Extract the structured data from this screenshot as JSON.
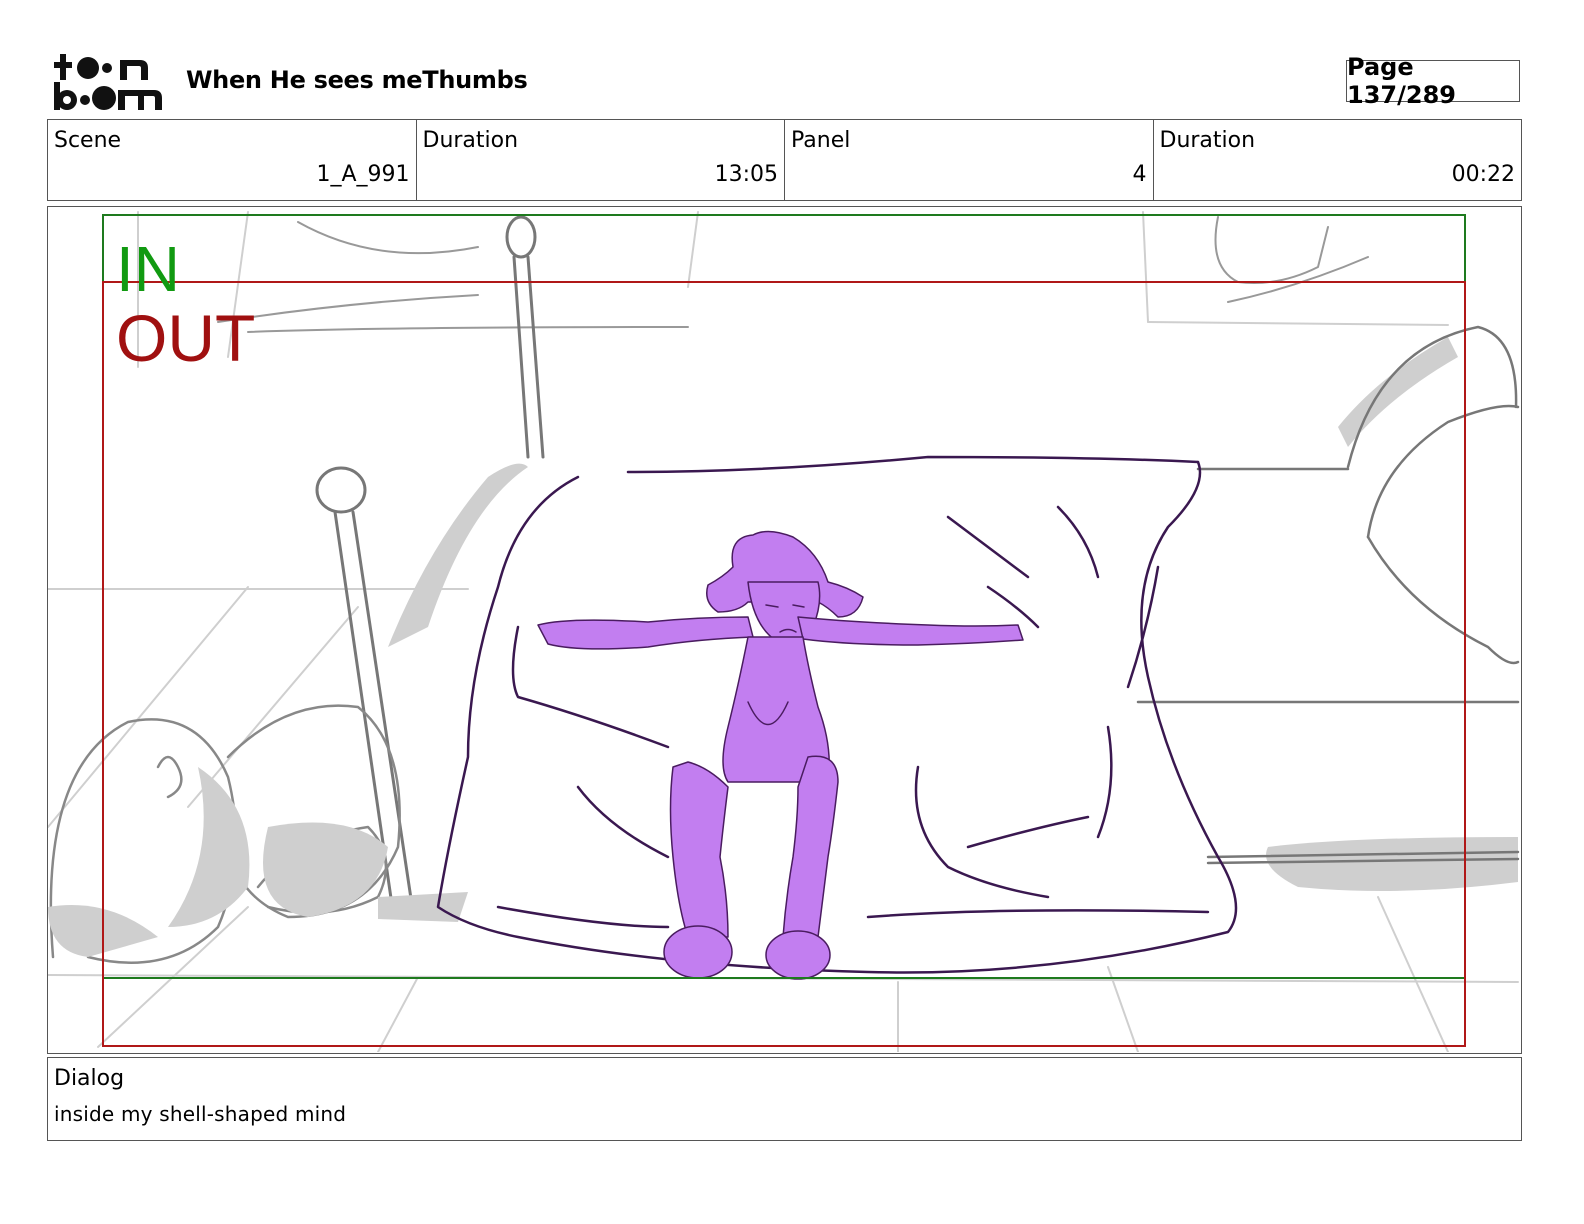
{
  "header": {
    "logo_text": "toon boom",
    "title": "When He sees meThumbs",
    "page": "Page 137/289"
  },
  "info": {
    "scene_label": "Scene",
    "scene_value": "1_A_991",
    "duration_label": "Duration",
    "duration_value": "13:05",
    "panel_label": "Panel",
    "panel_value": "4",
    "panel_duration_label": "Duration",
    "panel_duration_value": "00:22"
  },
  "frame": {
    "in_label": "IN",
    "out_label": "OUT",
    "in_color": "#119a11",
    "out_color": "#a01010",
    "character_color": "#c27ef0"
  },
  "dialog": {
    "label": "Dialog",
    "text": "inside my shell-shaped mind"
  }
}
